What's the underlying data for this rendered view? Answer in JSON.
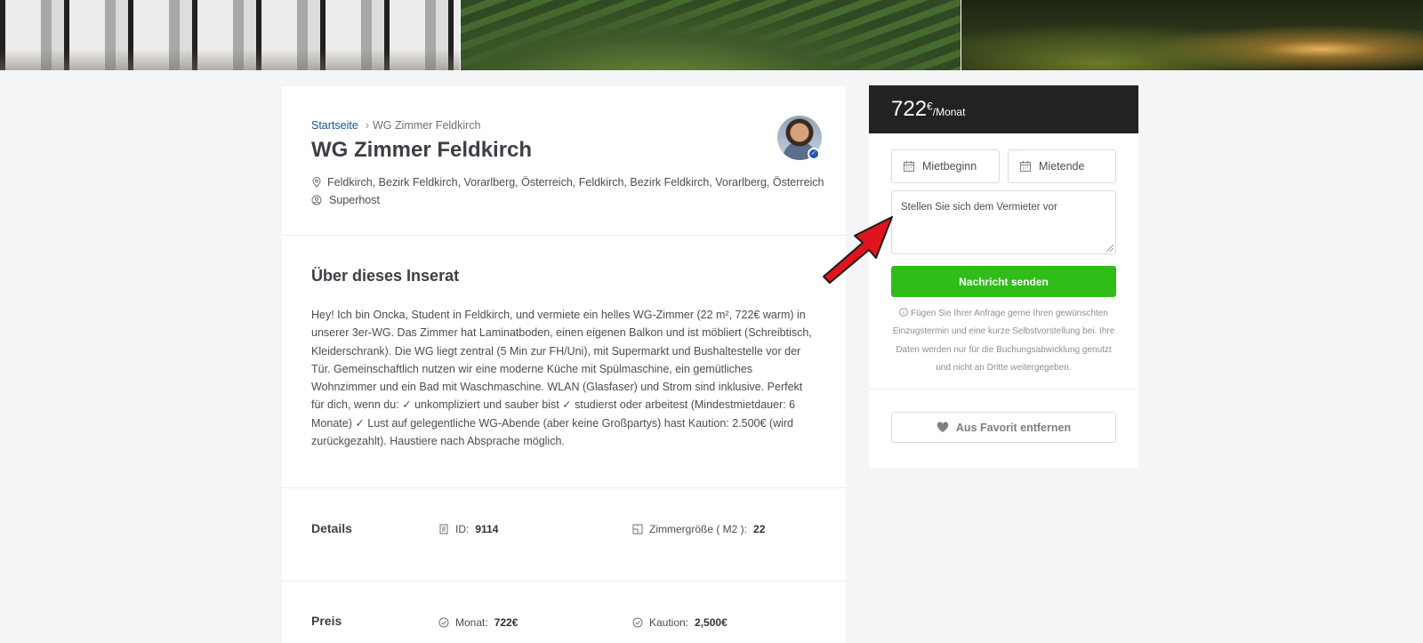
{
  "listing": {
    "breadcrumb_home": "Startseite",
    "breadcrumb_sep": "›",
    "breadcrumb_current": "WG Zimmer Feldkirch",
    "title": "WG Zimmer Feldkirch",
    "location": "Feldkirch, Bezirk Feldkirch, Vorarlberg, Österreich, Feldkirch, Bezirk Feldkirch, Vorarlberg, Österreich",
    "host_label": "Superhost"
  },
  "about": {
    "heading": "Über dieses Inserat",
    "text": "Hey! Ich bin Oncka, Student in Feldkirch, und vermiete ein helles WG-Zimmer (22 m², 722€ warm) in unserer 3er-WG. Das Zimmer hat Laminatboden, einen eigenen Balkon und ist möbliert (Schreibtisch, Kleiderschrank). Die WG liegt zentral (5 Min zur FH/Uni), mit Supermarkt und Bushaltestelle vor der Tür. Gemeinschaftlich nutzen wir eine moderne Küche mit Spülmaschine, ein gemütliches Wohnzimmer und ein Bad mit Waschmaschine. WLAN (Glasfaser) und Strom sind inklusive. Perfekt für dich, wenn du: ✓ unkompliziert und sauber bist ✓ studierst oder arbeitest (Mindestmietdauer: 6 Monate) ✓ Lust auf gelegentliche WG-Abende (aber keine Großpartys) hast Kaution: 2.500€ (wird zurückgezahlt). Haustiere nach Absprache möglich."
  },
  "details": {
    "label": "Details",
    "id_label": "ID:",
    "id_value": "9114",
    "size_label": "Zimmergröße ( M2 ):",
    "size_value": "22"
  },
  "preis": {
    "label": "Preis",
    "monat_label": "Monat:",
    "monat_value": "722€",
    "kaution_label": "Kaution:",
    "kaution_value": "2,500€"
  },
  "booking": {
    "price": "722",
    "currency": "€",
    "per": "/Monat",
    "start_placeholder": "Mietbeginn",
    "end_placeholder": "Mietende",
    "message_placeholder": "Stellen Sie sich dem Vermieter vor",
    "send_label": "Nachricht senden",
    "note": "Fügen Sie Ihrer Anfrage gerne Ihren gewünschten Einzugstermin und eine kurze Selbstvorstellung bei. Ihre Daten werden nur für die Buchungsabwicklung genutzt und nicht an Dritte weitergegeben.",
    "favorite_label": "Aus Favorit entfernen"
  },
  "colors": {
    "send_button": "#2fbd17",
    "price_bar": "#222222",
    "link": "#1f4fa0",
    "annotation_arrow": "#e0141c"
  }
}
